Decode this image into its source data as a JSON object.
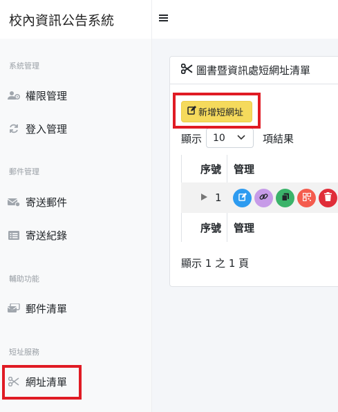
{
  "brand": "校內資訊公告系統",
  "sidebar": {
    "sections": [
      {
        "header": "系統管理",
        "items": [
          {
            "label": "權限管理",
            "icon": "users-cog-icon"
          },
          {
            "label": "登入管理",
            "icon": "sync-icon"
          }
        ]
      },
      {
        "header": "郵件管理",
        "items": [
          {
            "label": "寄送郵件",
            "icon": "mail-send-icon"
          },
          {
            "label": "寄送紀錄",
            "icon": "list-icon"
          }
        ]
      },
      {
        "header": "輔助功能",
        "items": [
          {
            "label": "郵件清單",
            "icon": "mail-list-icon"
          }
        ]
      },
      {
        "header": "短址服務",
        "items": [
          {
            "label": "網址清單",
            "icon": "scissors-icon"
          }
        ]
      }
    ]
  },
  "topbar": {
    "menu_icon": "hamburger-icon"
  },
  "card": {
    "title": "圖書暨資訊處短網址清單",
    "add_button": "新增短網址",
    "length": {
      "prefix": "顯示",
      "value": "10",
      "suffix": "項結果"
    },
    "table": {
      "headers": [
        "序號",
        "管理"
      ],
      "rows": [
        {
          "num": "1"
        }
      ],
      "footer": [
        "序號",
        "管理"
      ]
    },
    "info": "顯示 1 之 1 頁"
  },
  "actions": [
    {
      "name": "edit",
      "icon": "edit-icon",
      "color": "#2d9bf0"
    },
    {
      "name": "link",
      "icon": "link-icon",
      "color": "#c79be8"
    },
    {
      "name": "copy",
      "icon": "copy-icon",
      "color": "#3bb36a"
    },
    {
      "name": "qrcode",
      "icon": "qrcode-icon",
      "color": "#f45c4e"
    },
    {
      "name": "delete",
      "icon": "trash-icon",
      "color": "#e02d39"
    }
  ]
}
